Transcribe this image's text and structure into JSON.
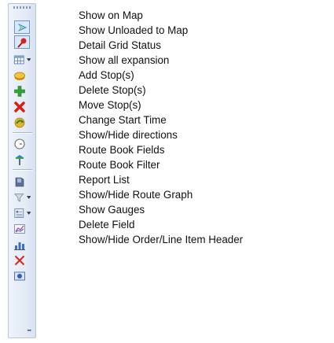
{
  "toolbar": {
    "buttons": [
      {
        "icon": "show-on-map-icon",
        "label": "Show on Map"
      },
      {
        "icon": "show-unloaded-to-map-icon",
        "label": "Show Unloaded to Map"
      },
      {
        "icon": "detail-grid-status-icon",
        "label": "Detail Grid Status"
      },
      {
        "icon": "show-all-expansion-icon",
        "label": "Show all expansion"
      },
      {
        "icon": "add-stop-icon",
        "label": "Add Stop(s)"
      },
      {
        "icon": "delete-stop-icon",
        "label": "Delete Stop(s)"
      },
      {
        "icon": "move-stop-icon",
        "label": "Move Stop(s)"
      },
      {
        "icon": "change-start-time-icon",
        "label": "Change Start Time"
      },
      {
        "icon": "show-hide-directions-icon",
        "label": "Show/Hide directions"
      },
      {
        "icon": "route-book-fields-icon",
        "label": "Route Book Fields"
      },
      {
        "icon": "route-book-filter-icon",
        "label": "Route Book Filter"
      },
      {
        "icon": "report-list-icon",
        "label": "Report List"
      },
      {
        "icon": "show-hide-route-graph-icon",
        "label": "Show/Hide Route Graph"
      },
      {
        "icon": "show-gauges-icon",
        "label": "Show Gauges"
      },
      {
        "icon": "delete-field-icon",
        "label": "Delete Field"
      },
      {
        "icon": "show-hide-order-line-item-header-icon",
        "label": "Show/Hide Order/Line Item Header"
      }
    ]
  }
}
